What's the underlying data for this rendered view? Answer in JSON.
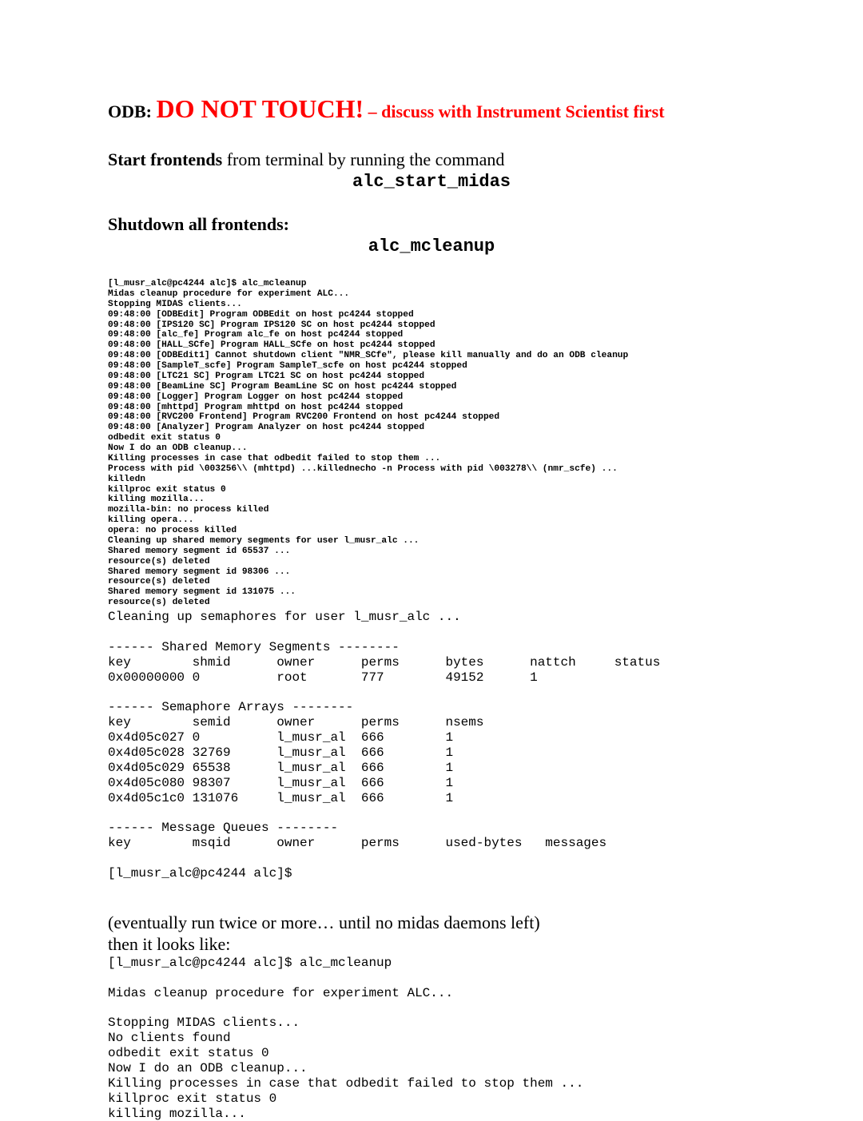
{
  "heading_odb": {
    "label": "ODB: ",
    "warn_big": "DO NOT TOUCH!",
    "warn_rest": " – discuss with Instrument Scientist first"
  },
  "heading_start": {
    "bold": "Start frontends",
    "rest": " from terminal by running the command"
  },
  "cmd_start": "alc_start_midas",
  "heading_shutdown": "Shutdown all frontends:",
  "cmd_cleanup": "alc_mcleanup",
  "terminal_small": "[l_musr_alc@pc4244 alc]$ alc_mcleanup\nMidas cleanup procedure for experiment ALC...\nStopping MIDAS clients...\n09:48:00 [ODBEdit] Program ODBEdit on host pc4244 stopped\n09:48:00 [IPS120 SC] Program IPS120 SC on host pc4244 stopped\n09:48:00 [alc_fe] Program alc_fe on host pc4244 stopped\n09:48:00 [HALL_SCfe] Program HALL_SCfe on host pc4244 stopped\n09:48:00 [ODBEdit1] Cannot shutdown client \"NMR_SCfe\", please kill manually and do an ODB cleanup\n09:48:00 [SampleT_scfe] Program SampleT_scfe on host pc4244 stopped\n09:48:00 [LTC21 SC] Program LTC21 SC on host pc4244 stopped\n09:48:00 [BeamLine SC] Program BeamLine SC on host pc4244 stopped\n09:48:00 [Logger] Program Logger on host pc4244 stopped\n09:48:00 [mhttpd] Program mhttpd on host pc4244 stopped\n09:48:00 [RVC200 Frontend] Program RVC200 Frontend on host pc4244 stopped\n09:48:00 [Analyzer] Program Analyzer on host pc4244 stopped\nodbedit exit status 0\nNow I do an ODB cleanup...\nKilling processes in case that odbedit failed to stop them ...\nProcess with pid \\003256\\\\ (mhttpd) ...killednecho -n Process with pid \\003278\\\\ (nmr_scfe) ...\nkilledn\nkillproc exit status 0\nkilling mozilla...\nmozilla-bin: no process killed\nkilling opera...\nopera: no process killed\nCleaning up shared memory segments for user l_musr_alc ...\nShared memory segment id 65537 ...\nresource(s) deleted\nShared memory segment id 98306 ...\nresource(s) deleted\nShared memory segment id 131075 ...\nresource(s) deleted",
  "terminal_large": "Cleaning up semaphores for user l_musr_alc ...\n\n------ Shared Memory Segments --------\nkey        shmid      owner      perms      bytes      nattch     status\n0x00000000 0          root       777        49152      1\n\n------ Semaphore Arrays --------\nkey        semid      owner      perms      nsems\n0x4d05c027 0          l_musr_al  666        1\n0x4d05c028 32769      l_musr_al  666        1\n0x4d05c029 65538      l_musr_al  666        1\n0x4d05c080 98307      l_musr_al  666        1\n0x4d05c1c0 131076     l_musr_al  666        1\n\n------ Message Queues --------\nkey        msqid      owner      perms      used-bytes   messages\n\n[l_musr_alc@pc4244 alc]$",
  "eventually": {
    "line1": "(eventually run twice or more… until no midas daemons left)",
    "line2": "then it looks like:"
  },
  "terminal_large_2": "[l_musr_alc@pc4244 alc]$ alc_mcleanup\n\nMidas cleanup procedure for experiment ALC...\n\nStopping MIDAS clients...\nNo clients found\nodbedit exit status 0\nNow I do an ODB cleanup...\nKilling processes in case that odbedit failed to stop them ...\nkillproc exit status 0\nkilling mozilla..."
}
